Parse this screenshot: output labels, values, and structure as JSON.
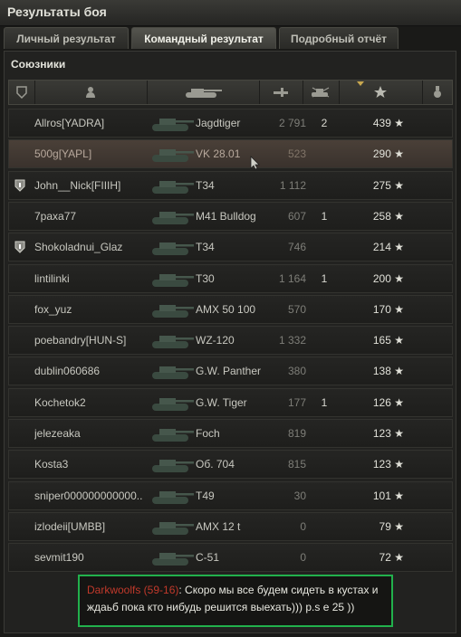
{
  "window": {
    "title": "Результаты боя"
  },
  "tabs": [
    {
      "label": "Личный результат"
    },
    {
      "label": "Командный результат"
    },
    {
      "label": "Подробный отчёт"
    }
  ],
  "team": {
    "title": "Союзники"
  },
  "columns": [
    {
      "icon": "clan-badge-icon"
    },
    {
      "icon": "player-icon"
    },
    {
      "icon": "tank-icon"
    },
    {
      "icon": "damage-icon"
    },
    {
      "icon": "kills-icon"
    },
    {
      "icon": "experience-star-icon",
      "sorted": true
    },
    {
      "icon": "medal-icon"
    }
  ],
  "players": [
    {
      "name": "Allros[YADRA]",
      "tank": "Jagdtiger",
      "damage": "2 791",
      "kills": "2",
      "xp": "439",
      "badge": false,
      "highlight": false
    },
    {
      "name": "500g[YAPL]",
      "tank": "VK 28.01",
      "damage": "523",
      "kills": "",
      "xp": "290",
      "badge": false,
      "highlight": true
    },
    {
      "name": "John__Nick[FIIIH]",
      "tank": "T34",
      "damage": "1 112",
      "kills": "",
      "xp": "275",
      "badge": true,
      "highlight": false
    },
    {
      "name": "7paxa77",
      "tank": "M41 Bulldog",
      "damage": "607",
      "kills": "1",
      "xp": "258",
      "badge": false,
      "highlight": false
    },
    {
      "name": "Shokoladnui_Glaz",
      "tank": "T34",
      "damage": "746",
      "kills": "",
      "xp": "214",
      "badge": true,
      "highlight": false
    },
    {
      "name": "lintilinki",
      "tank": "T30",
      "damage": "1 164",
      "kills": "1",
      "xp": "200",
      "badge": false,
      "highlight": false
    },
    {
      "name": "fox_yuz",
      "tank": "AMX 50 100",
      "damage": "570",
      "kills": "",
      "xp": "170",
      "badge": false,
      "highlight": false
    },
    {
      "name": "poebandry[HUN-S]",
      "tank": "WZ-120",
      "damage": "1 332",
      "kills": "",
      "xp": "165",
      "badge": false,
      "highlight": false
    },
    {
      "name": "dublin060686",
      "tank": "G.W. Panther",
      "damage": "380",
      "kills": "",
      "xp": "138",
      "badge": false,
      "highlight": false
    },
    {
      "name": "Kochetok2",
      "tank": "G.W. Tiger",
      "damage": "177",
      "kills": "1",
      "xp": "126",
      "badge": false,
      "highlight": false
    },
    {
      "name": "jelezeaka",
      "tank": "Foch",
      "damage": "819",
      "kills": "",
      "xp": "123",
      "badge": false,
      "highlight": false
    },
    {
      "name": "Kosta3",
      "tank": "Об. 704",
      "damage": "815",
      "kills": "",
      "xp": "123",
      "badge": false,
      "highlight": false
    },
    {
      "name": "sniper000000000000..",
      "tank": "T49",
      "damage": "30",
      "kills": "",
      "xp": "101",
      "badge": false,
      "highlight": false
    },
    {
      "name": "izlodeii[UMBB]",
      "tank": "AMX 12 t",
      "damage": "0",
      "kills": "",
      "xp": "79",
      "badge": false,
      "highlight": false
    },
    {
      "name": "sevmit190",
      "tank": "С-51",
      "damage": "0",
      "kills": "",
      "xp": "72",
      "badge": false,
      "highlight": false
    }
  ],
  "star_glyph": "★",
  "chat": {
    "sender": "Darkwoolfs (59-16)",
    "message": "Скоро мы все будем сидеть в кустах и ждаьб пока кто нибудь решится выехать))) p.s е 25 ))"
  },
  "colors": {
    "chat_border": "#22b14c",
    "sender": "#c0392b",
    "highlight_row": "#4a4038"
  }
}
